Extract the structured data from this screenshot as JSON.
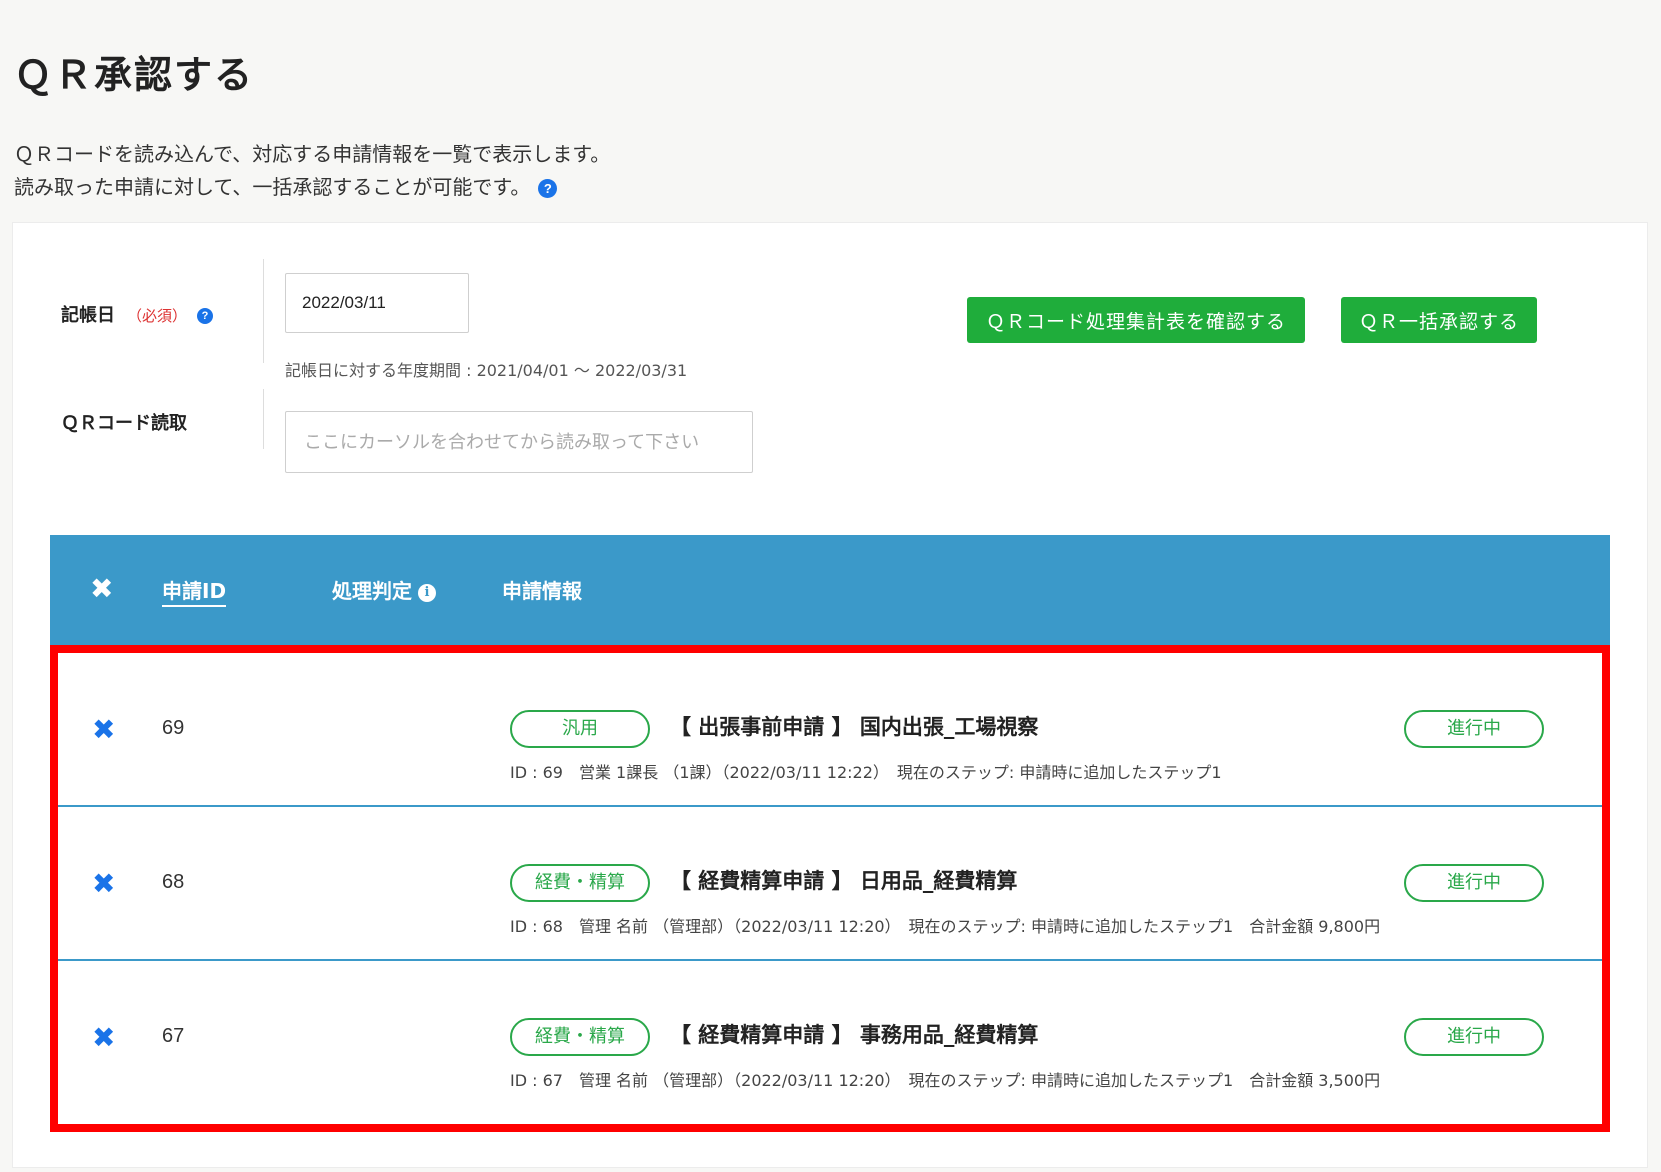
{
  "page": {
    "title": "ＱＲ承認する",
    "description_line1": "ＱＲコードを読み込んで、対応する申請情報を一覧で表示します。",
    "description_line2": "読み取った申請に対して、一括承認することが可能です。"
  },
  "form": {
    "date_label": "記帳日",
    "required_label": "（必須）",
    "date_value": "2022/03/11",
    "period_note": "記帳日に対する年度期間 : 2021/04/01 〜 2022/03/31",
    "qr_label": "ＱＲコード読取",
    "qr_placeholder": "ここにカーソルを合わせてから読み取って下さい"
  },
  "buttons": {
    "summary": "ＱＲコード処理集計表を確認する",
    "bulk_approve": "ＱＲ一括承認する"
  },
  "table": {
    "headers": {
      "id": "申請ID",
      "judgement": "処理判定",
      "info": "申請情報"
    },
    "rows": [
      {
        "id": "69",
        "category": "汎用",
        "title": "【 出張事前申請 】 国内出張_工場視察",
        "meta": "ID : 69　営業 1課長 （1課）（2022/03/11 12:22）　現在のステップ: 申請時に追加したステップ1",
        "status": "進行中"
      },
      {
        "id": "68",
        "category": "経費・精算",
        "title": "【 経費精算申請 】 日用品_経費精算",
        "meta": "ID : 68　管理 名前 （管理部）（2022/03/11 12:20）　現在のステップ: 申請時に追加したステップ1　合計金額 9,800円",
        "status": "進行中"
      },
      {
        "id": "67",
        "category": "経費・精算",
        "title": "【 経費精算申請 】 事務用品_経費精算",
        "meta": "ID : 67　管理 名前 （管理部）（2022/03/11 12:20）　現在のステップ: 申請時に追加したステップ1　合計金額 3,500円",
        "status": "進行中"
      }
    ]
  },
  "icons": {
    "help": "question-circle-icon",
    "info": "info-circle-icon",
    "remove": "close-x-icon"
  },
  "colors": {
    "accent_green": "#1fad3b",
    "header_blue": "#3b99c9",
    "remove_blue": "#1a73e8",
    "highlight_red": "#ff0000"
  }
}
